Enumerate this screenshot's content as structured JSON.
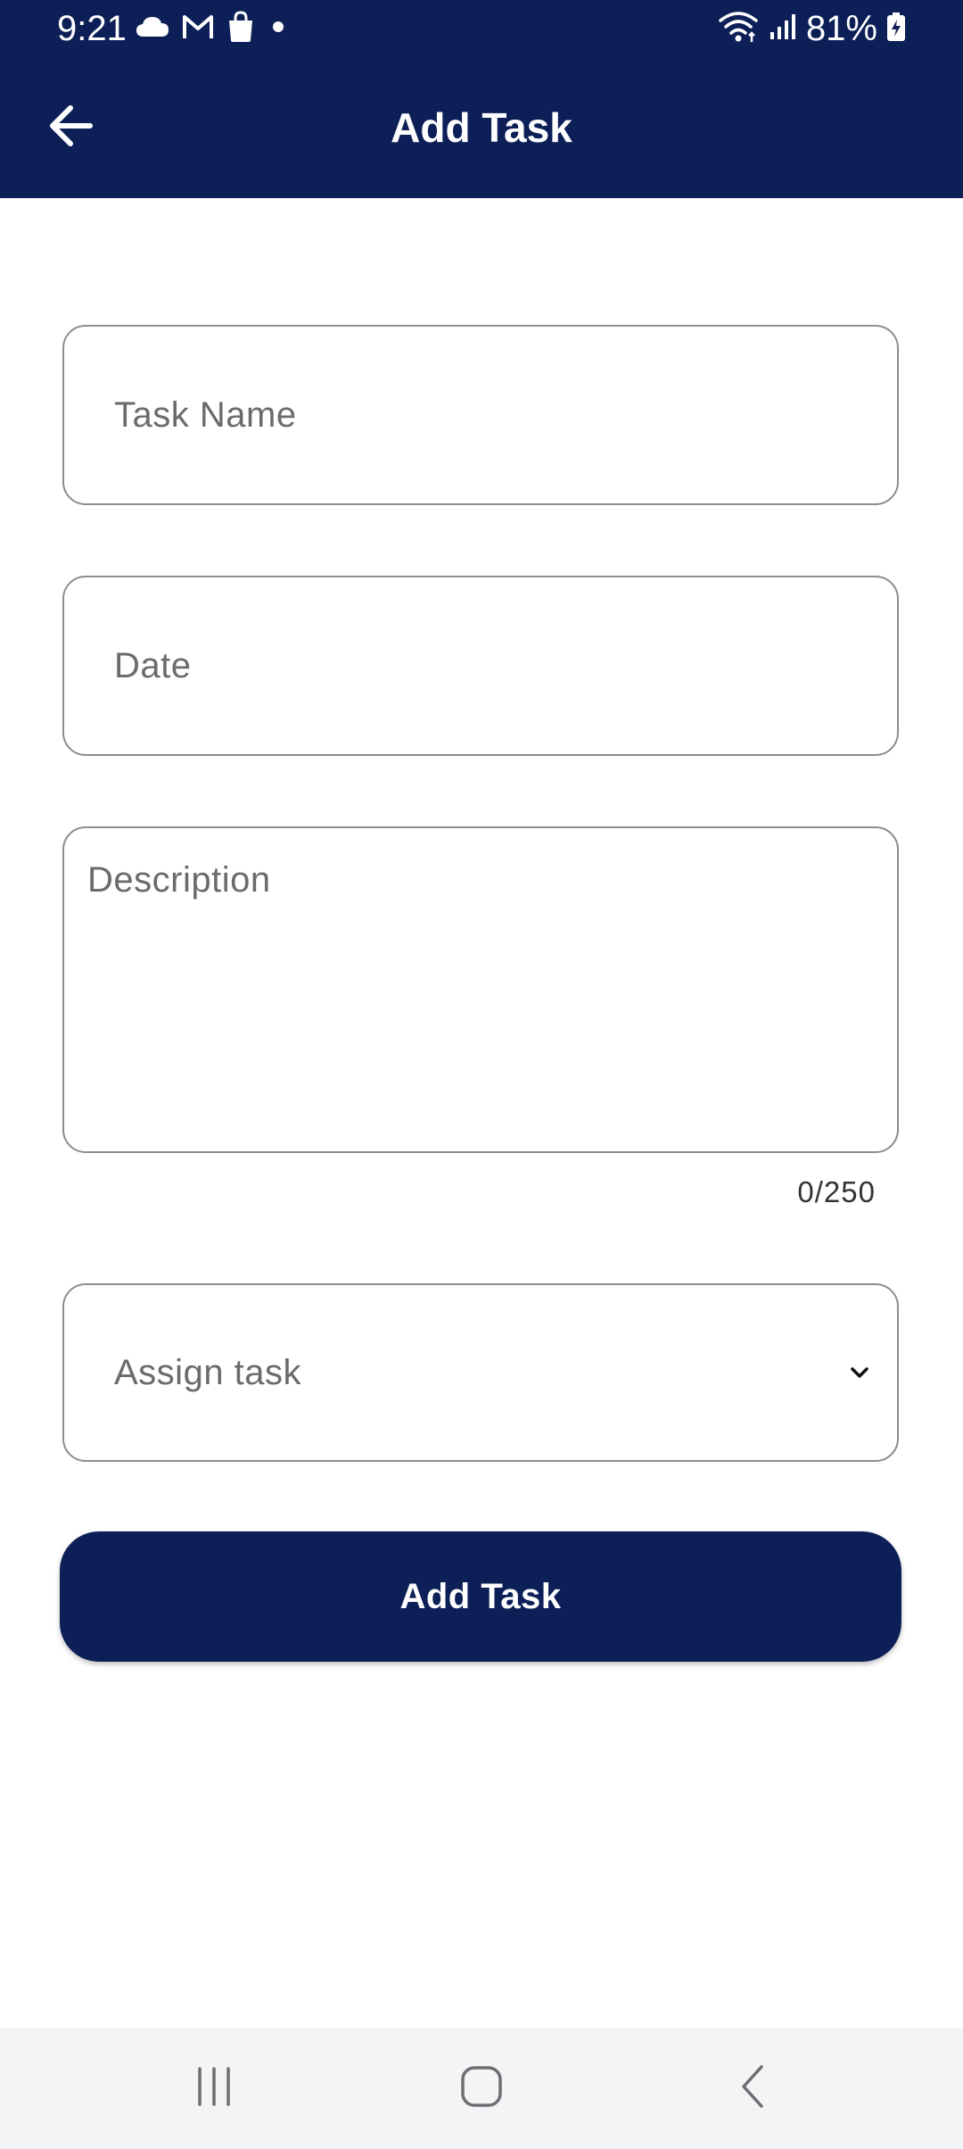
{
  "status_bar": {
    "time": "9:21",
    "battery_percent": "81%",
    "left_icons": [
      "cloud-icon",
      "gmail-icon",
      "shopping-bag-icon",
      "dot-icon"
    ],
    "right_icons": [
      "wifi-icon",
      "signal-icon",
      "battery-charging-icon"
    ]
  },
  "app_bar": {
    "title": "Add Task",
    "back_icon": "back-arrow-icon",
    "background_color": "#0c1f57"
  },
  "form": {
    "task_name": {
      "value": "",
      "placeholder": "Task Name"
    },
    "date": {
      "value": "",
      "placeholder": "Date"
    },
    "description": {
      "value": "",
      "placeholder": "Description",
      "counter": "0/250"
    },
    "assign": {
      "selected": "Assign task",
      "icon": "chevron-down-icon"
    },
    "submit_label": "Add Task"
  },
  "nav_bar": {
    "buttons": [
      "recents-icon",
      "home-icon",
      "back-icon"
    ]
  }
}
